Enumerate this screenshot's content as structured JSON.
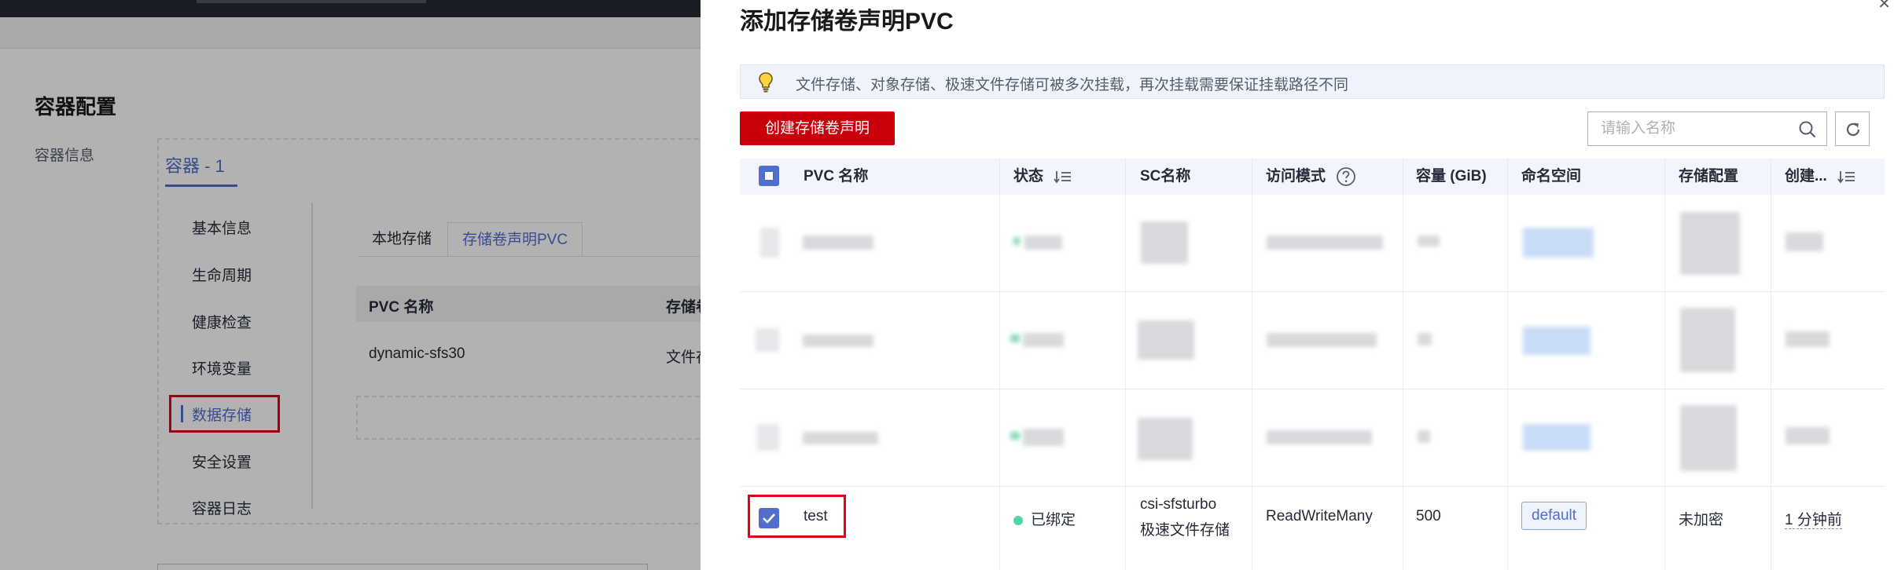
{
  "background": {
    "section_title": "容器配置",
    "left_label": "容器信息",
    "container_tab": "容器 - 1",
    "menu": [
      "基本信息",
      "生命周期",
      "健康检查",
      "环境变量",
      "数据存储",
      "安全设置",
      "容器日志"
    ],
    "menu_active": "数据存储",
    "subtabs": [
      "本地存储",
      "存储卷声明PVC"
    ],
    "table_headers": [
      "PVC 名称",
      "存储卷"
    ],
    "table_row": [
      "dynamic-sfs30",
      "文件存"
    ]
  },
  "drawer": {
    "title": "添加存储卷声明PVC",
    "tip": "文件存储、对象存储、极速文件存储可被多次挂载，再次挂载需要保证挂载路径不同",
    "create_button": "创建存储卷声明",
    "search_placeholder": "请输入名称",
    "columns": {
      "pvc_name": "PVC 名称",
      "status": "状态",
      "sc_name": "SC名称",
      "access_mode": "访问模式",
      "capacity": "容量 (GiB)",
      "namespace": "命名空间",
      "storage_config": "存储配置",
      "created": "创建..."
    },
    "selected_row": {
      "pvc_name": "test",
      "status": "已绑定",
      "sc_name_line1": "csi-sfsturbo",
      "sc_name_line2": "极速文件存储",
      "access_mode": "ReadWriteMany",
      "capacity": "500",
      "namespace": "default",
      "storage_config": "未加密",
      "created": "1 分钟前"
    }
  },
  "colors": {
    "primary": "#526ecc",
    "danger": "#c7000b",
    "highlight_border": "#e60012",
    "status_green": "#50d4ab"
  }
}
